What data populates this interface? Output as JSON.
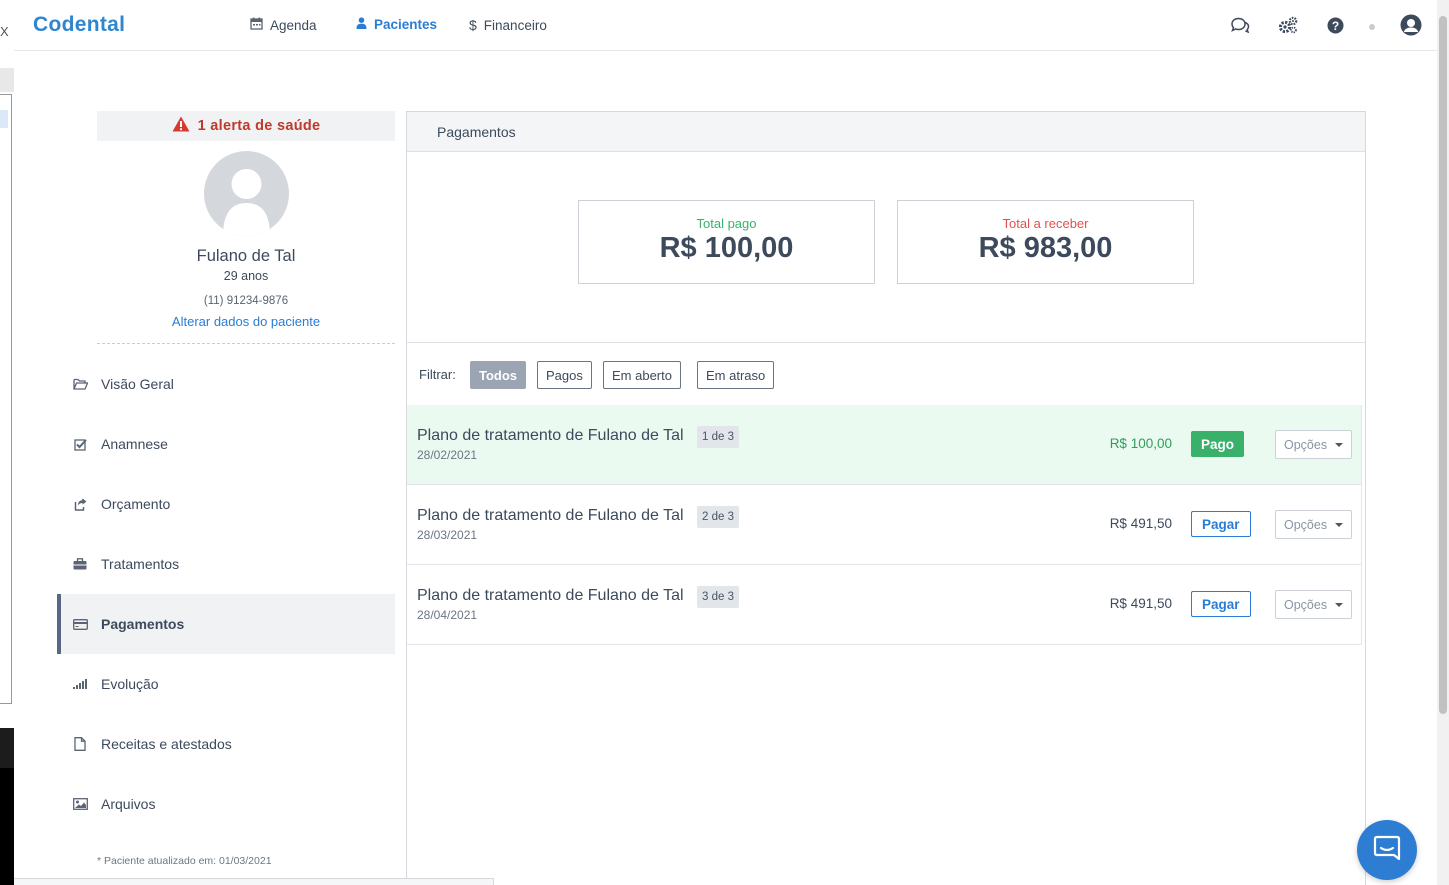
{
  "app": {
    "brand": "Codental"
  },
  "nav": {
    "items": [
      {
        "label": "Agenda",
        "icon": "calendar-icon"
      },
      {
        "label": "Pacientes",
        "icon": "user-icon",
        "active": true
      },
      {
        "label": "Financeiro",
        "icon": "dollar-icon"
      }
    ]
  },
  "top_icons": [
    "chat-icon",
    "gears-icon",
    "help-icon",
    "status-dot-icon",
    "user-avatar-icon"
  ],
  "sidebar": {
    "alert": "1 alerta de saúde",
    "patient": {
      "name": "Fulano de Tal",
      "age": "29 anos",
      "phone": "(11) 91234-9876",
      "edit_link": "Alterar dados do paciente"
    },
    "menu": [
      {
        "label": "Visão Geral",
        "icon": "folder-open-icon"
      },
      {
        "label": "Anamnese",
        "icon": "checkbox-icon"
      },
      {
        "label": "Orçamento",
        "icon": "share-icon"
      },
      {
        "label": "Tratamentos",
        "icon": "briefcase-icon"
      },
      {
        "label": "Pagamentos",
        "icon": "credit-card-icon",
        "active": true
      },
      {
        "label": "Evolução",
        "icon": "signal-bars-icon"
      },
      {
        "label": "Receitas e atestados",
        "icon": "file-icon"
      },
      {
        "label": "Arquivos",
        "icon": "image-icon"
      }
    ],
    "updated_note": "* Paciente atualizado em: 01/03/2021"
  },
  "panel": {
    "title": "Pagamentos",
    "stats": {
      "paid_label": "Total pago",
      "paid_value": "R$ 100,00",
      "receivable_label": "Total a receber",
      "receivable_value": "R$ 983,00"
    },
    "filter": {
      "label": "Filtrar:",
      "options": [
        "Todos",
        "Pagos",
        "Em aberto",
        "Em atraso"
      ],
      "selected": "Todos"
    },
    "payments": [
      {
        "title": "Plano de tratamento de Fulano de Tal",
        "installment": "1 de 3",
        "date": "28/02/2021",
        "amount": "R$ 100,00",
        "status": "Pago",
        "paid": true,
        "options": "Opções"
      },
      {
        "title": "Plano de tratamento de Fulano de Tal",
        "installment": "2 de 3",
        "date": "28/03/2021",
        "amount": "R$ 491,50",
        "status": "Pagar",
        "paid": false,
        "options": "Opções"
      },
      {
        "title": "Plano de tratamento de Fulano de Tal",
        "installment": "3 de 3",
        "date": "28/04/2021",
        "amount": "R$ 491,50",
        "status": "Pagar",
        "paid": false,
        "options": "Opções"
      }
    ]
  },
  "colors": {
    "brand": "#2e86cf",
    "paid_green": "#3ab16a",
    "receivable_red": "#e05252",
    "alert_red": "#c0392b",
    "link_blue": "#2a7dd4"
  },
  "edge": {
    "x_glyph": "X"
  }
}
